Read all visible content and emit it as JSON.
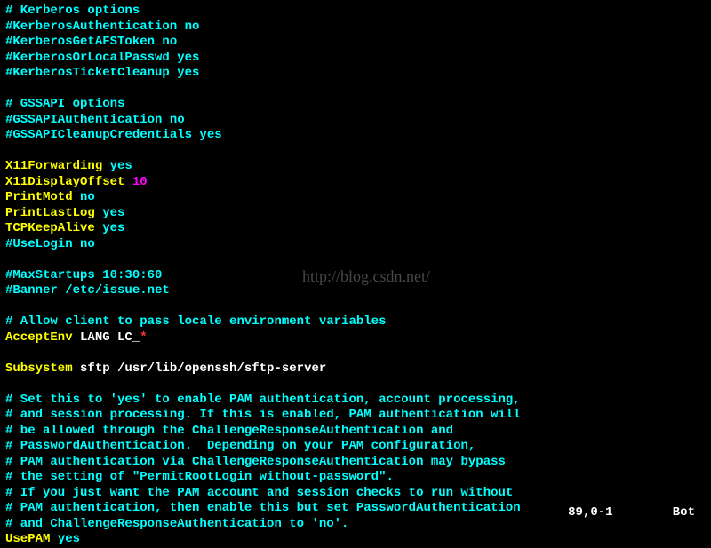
{
  "lines": [
    [
      {
        "c": "cyan",
        "t": "# Kerberos options"
      }
    ],
    [
      {
        "c": "cyan",
        "t": "#KerberosAuthentication no"
      }
    ],
    [
      {
        "c": "cyan",
        "t": "#KerberosGetAFSToken no"
      }
    ],
    [
      {
        "c": "cyan",
        "t": "#KerberosOrLocalPasswd yes"
      }
    ],
    [
      {
        "c": "cyan",
        "t": "#KerberosTicketCleanup yes"
      }
    ],
    [],
    [
      {
        "c": "cyan",
        "t": "# GSSAPI options"
      }
    ],
    [
      {
        "c": "cyan",
        "t": "#GSSAPIAuthentication no"
      }
    ],
    [
      {
        "c": "cyan",
        "t": "#GSSAPICleanupCredentials yes"
      }
    ],
    [],
    [
      {
        "c": "yellow",
        "t": "X11Forwarding"
      },
      {
        "c": "white",
        "t": " "
      },
      {
        "c": "cyan",
        "t": "yes"
      }
    ],
    [
      {
        "c": "yellow",
        "t": "X11DisplayOffset"
      },
      {
        "c": "white",
        "t": " "
      },
      {
        "c": "magenta",
        "t": "10"
      }
    ],
    [
      {
        "c": "yellow",
        "t": "PrintMotd"
      },
      {
        "c": "white",
        "t": " "
      },
      {
        "c": "cyan",
        "t": "no"
      }
    ],
    [
      {
        "c": "yellow",
        "t": "PrintLastLog"
      },
      {
        "c": "white",
        "t": " "
      },
      {
        "c": "cyan",
        "t": "yes"
      }
    ],
    [
      {
        "c": "yellow",
        "t": "TCPKeepAlive"
      },
      {
        "c": "white",
        "t": " "
      },
      {
        "c": "cyan",
        "t": "yes"
      }
    ],
    [
      {
        "c": "cyan",
        "t": "#UseLogin no"
      }
    ],
    [],
    [
      {
        "c": "cyan",
        "t": "#MaxStartups 10:30:60"
      }
    ],
    [
      {
        "c": "cyan",
        "t": "#Banner /etc/issue.net"
      }
    ],
    [],
    [
      {
        "c": "cyan",
        "t": "# Allow client to pass locale environment variables"
      }
    ],
    [
      {
        "c": "yellow",
        "t": "AcceptEnv"
      },
      {
        "c": "white",
        "t": " LANG LC_"
      },
      {
        "c": "red",
        "t": "*"
      }
    ],
    [],
    [
      {
        "c": "yellow",
        "t": "Subsystem"
      },
      {
        "c": "white",
        "t": " sftp /usr/lib/openssh/sftp-server"
      }
    ],
    [],
    [
      {
        "c": "cyan",
        "t": "# Set this to 'yes' to enable PAM authentication, account processing,"
      }
    ],
    [
      {
        "c": "cyan",
        "t": "# and session processing. If this is enabled, PAM authentication will"
      }
    ],
    [
      {
        "c": "cyan",
        "t": "# be allowed through the ChallengeResponseAuthentication and"
      }
    ],
    [
      {
        "c": "cyan",
        "t": "# PasswordAuthentication.  Depending on your PAM configuration,"
      }
    ],
    [
      {
        "c": "cyan",
        "t": "# PAM authentication via ChallengeResponseAuthentication may bypass"
      }
    ],
    [
      {
        "c": "cyan",
        "t": "# the setting of \"PermitRootLogin without-password\"."
      }
    ],
    [
      {
        "c": "cyan",
        "t": "# If you just want the PAM account and session checks to run without"
      }
    ],
    [
      {
        "c": "cyan",
        "t": "# PAM authentication, then enable this but set PasswordAuthentication"
      }
    ],
    [
      {
        "c": "cyan",
        "t": "# and ChallengeResponseAuthentication to 'no'."
      }
    ],
    [
      {
        "c": "yellow",
        "t": "UsePAM"
      },
      {
        "c": "white",
        "t": " "
      },
      {
        "c": "cyan",
        "t": "yes"
      }
    ]
  ],
  "watermark": "http://blog.csdn.net/",
  "status": {
    "pos": "89,0-1",
    "loc": "Bot"
  }
}
